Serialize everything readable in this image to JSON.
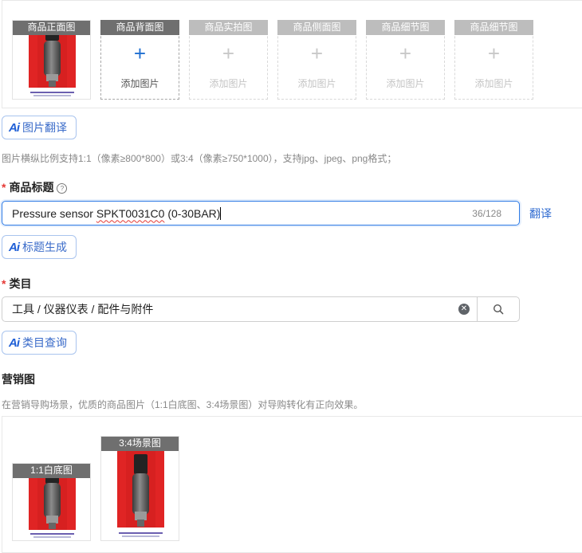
{
  "images": {
    "slots": [
      {
        "label": "商品正面图",
        "state": "filled"
      },
      {
        "label": "商品背面图",
        "state": "active",
        "add_text": "添加图片"
      },
      {
        "label": "商品实拍图",
        "state": "empty",
        "add_text": "添加图片"
      },
      {
        "label": "商品侧面图",
        "state": "empty",
        "add_text": "添加图片"
      },
      {
        "label": "商品细节图",
        "state": "empty",
        "add_text": "添加图片"
      },
      {
        "label": "商品细节图",
        "state": "empty",
        "add_text": "添加图片"
      }
    ],
    "plus_glyph": "+",
    "ai_button_label": "图片翻译",
    "hint": "图片横纵比例支持1:1（像素≥800*800）或3:4（像素≥750*1000），支持jpg、jpeg、png格式；"
  },
  "ai_badge": "Ai",
  "title_field": {
    "required_mark": "*",
    "label": "商品标题",
    "help_glyph": "?",
    "value_plain": "Pressure sensor ",
    "value_misspelled": "SPKT0031C0",
    "value_rest": " (0-30BAR)",
    "counter": "36/128",
    "translate_label": "翻译",
    "ai_button_label": "标题生成"
  },
  "category_field": {
    "required_mark": "*",
    "label": "类目",
    "value": "工具 / 仪器仪表 / 配件与附件",
    "clear_glyph": "✕",
    "ai_button_label": "类目查询"
  },
  "marketing": {
    "label": "营销图",
    "hint": "在营销导购场景，优质的商品图片（1:1白底图、3:4场景图）对导购转化有正向效果。",
    "images": [
      {
        "label": "1:1白底图"
      },
      {
        "label": "3:4场景图"
      }
    ]
  },
  "colors": {
    "accent": "#2f7be5",
    "link": "#2f6bd1",
    "required": "#e53935",
    "product_red": "#e02424"
  }
}
